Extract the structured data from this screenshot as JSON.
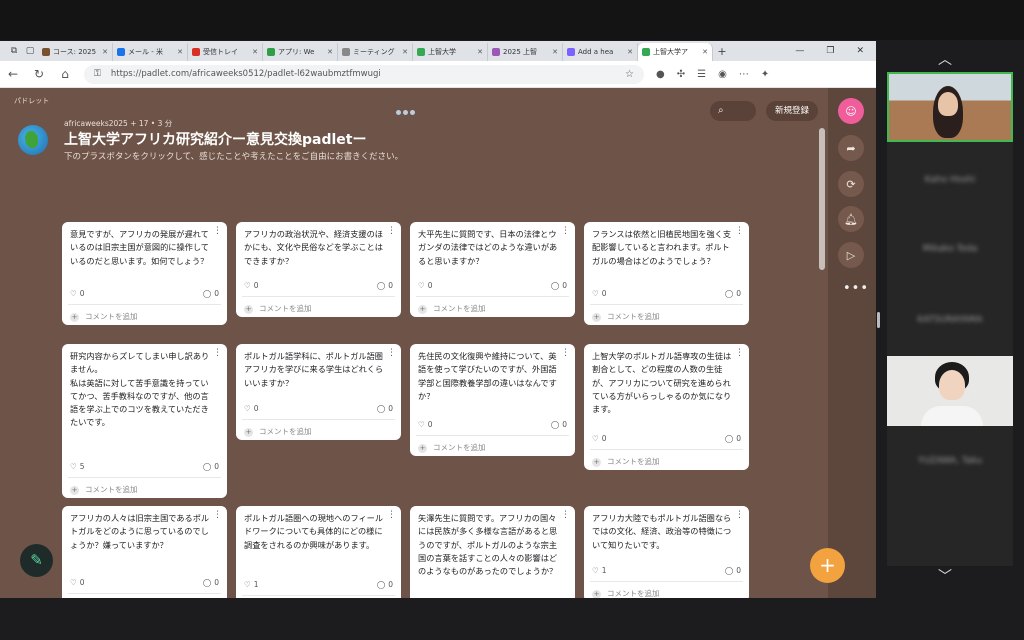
{
  "browser": {
    "tabs": [
      {
        "label": "コース: 2025",
        "color": "#7a5230"
      },
      {
        "label": "メール - 米",
        "color": "#1a73e8"
      },
      {
        "label": "受信トレイ",
        "color": "#d93025"
      },
      {
        "label": "アプリ: We",
        "color": "#2e9e47"
      },
      {
        "label": "ミーティング",
        "color": "#888888"
      },
      {
        "label": "上智大学",
        "color": "#34a853"
      },
      {
        "label": "2025 上智",
        "color": "#9b59b6"
      },
      {
        "label": "Add a hea",
        "color": "#7b61ff"
      },
      {
        "label": "上智大学ア",
        "color": "#34a853"
      }
    ],
    "url": "https://padlet.com/africaweeks0512/padlet-l62waubmztfmwugi"
  },
  "padlet": {
    "brand": "パドレット",
    "author": "africaweeks2025 + 17 • 3 分",
    "title": "上智大学アフリカ研究紹介ー意見交換padletー",
    "subtitle": "下のプラスボタンをクリックして、感じたことや考えたことをご自由にお書きください。",
    "signup_label": "新規登録",
    "comment_label": "コメントを追加",
    "cards": [
      {
        "text": "意見ですが、アフリカの発展が遅れているのは旧宗主国が意図的に操作しているのだと思います。如何でしょう？",
        "likes": "0",
        "comments": "0"
      },
      {
        "text": "アフリカの政治状況や、経済支援のほかにも、文化や民俗などを学ぶことはできますか？",
        "likes": "0",
        "comments": "0"
      },
      {
        "text": "大平先生に質問です、日本の法律とウガンダの法律ではどのような違いがあると思いますか？",
        "likes": "0",
        "comments": "0"
      },
      {
        "text": "フランスは依然と旧植民地国を強く支配影響していると言われます。ポルトガルの場合はどのようでしょう？",
        "likes": "0",
        "comments": "0"
      },
      {
        "text": "研究内容からズレてしまい申し訳ありません。\n私は英語に対して苦手意識を持っていてかつ、苦手教科なのですが、他の言語を学ぶ上でのコツを教えていただきたいです。",
        "likes": "5",
        "comments": "0"
      },
      {
        "text": "ポルトガル語学科に、ポルトガル語圏アフリカを学びに来る学生はどれくらいいますか？",
        "likes": "0",
        "comments": "0"
      },
      {
        "text": "先住民の文化復興や維持について、英語を使って学びたいのですが、外国語学部と国際教養学部の違いはなんですか？",
        "likes": "0",
        "comments": "0"
      },
      {
        "text": "上智大学のポルトガル語専攻の生徒は割合として、どの程度の人数の生徒が、アフリカについて研究を進められている方がいらっしゃるのか気になります。",
        "likes": "0",
        "comments": "0"
      },
      {
        "text": "アフリカの人々は旧宗主国であるポルトガルをどのように思っているのでしょうか？嫌っていますか？",
        "likes": "0",
        "comments": "0"
      },
      {
        "text": "ポルトガル語圏への現地へのフィールドワークについても具体的にどの様に調査をされるのか興味があります。",
        "likes": "1",
        "comments": "0"
      },
      {
        "text": "矢澤先生に質問です。アフリカの国々には民族が多く多様な言語があると思うのですが、ポルトガルのような宗主国の言葉を話すことの人々の影響はどのようなものがあったのでしょうか？",
        "likes": "0",
        "comments": "0"
      },
      {
        "text": "アフリカ大陸でもポルトガル語圏ならではの文化、経済、政治等の特徴について知りたいです。",
        "likes": "1",
        "comments": "0"
      }
    ]
  },
  "meeting": {
    "participants": [
      "Kaho Hoshi",
      "Mikako Toda",
      "KATSURAYAMA",
      "YUZAWA, Taku"
    ]
  },
  "icons": [
    "search-icon",
    "share-icon",
    "remix-icon",
    "bell-icon",
    "slideshow-icon",
    "more-icon",
    "add-post-icon",
    "edit-icon",
    "heart-icon",
    "comment-icon"
  ]
}
